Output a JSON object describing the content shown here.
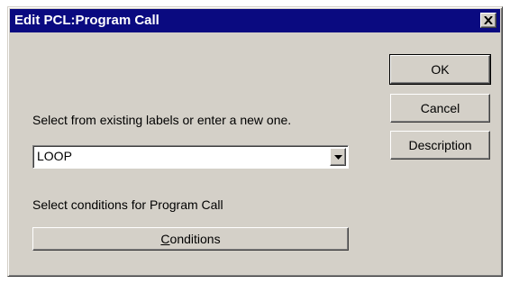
{
  "window": {
    "title": "Edit PCL:Program Call"
  },
  "icons": {
    "close": "close-icon",
    "dropdown": "chevron-down-icon"
  },
  "label_prompt": "Select from existing labels or enter a new one.",
  "label_combo": {
    "value": "LOOP"
  },
  "conditions_prompt": "Select conditions for Program Call",
  "buttons": {
    "ok": "OK",
    "cancel": "Cancel",
    "description": "Description",
    "conditions": "Conditions"
  },
  "colors": {
    "titlebar": "#0a0a80",
    "dialog_face": "#d4d0c8"
  }
}
